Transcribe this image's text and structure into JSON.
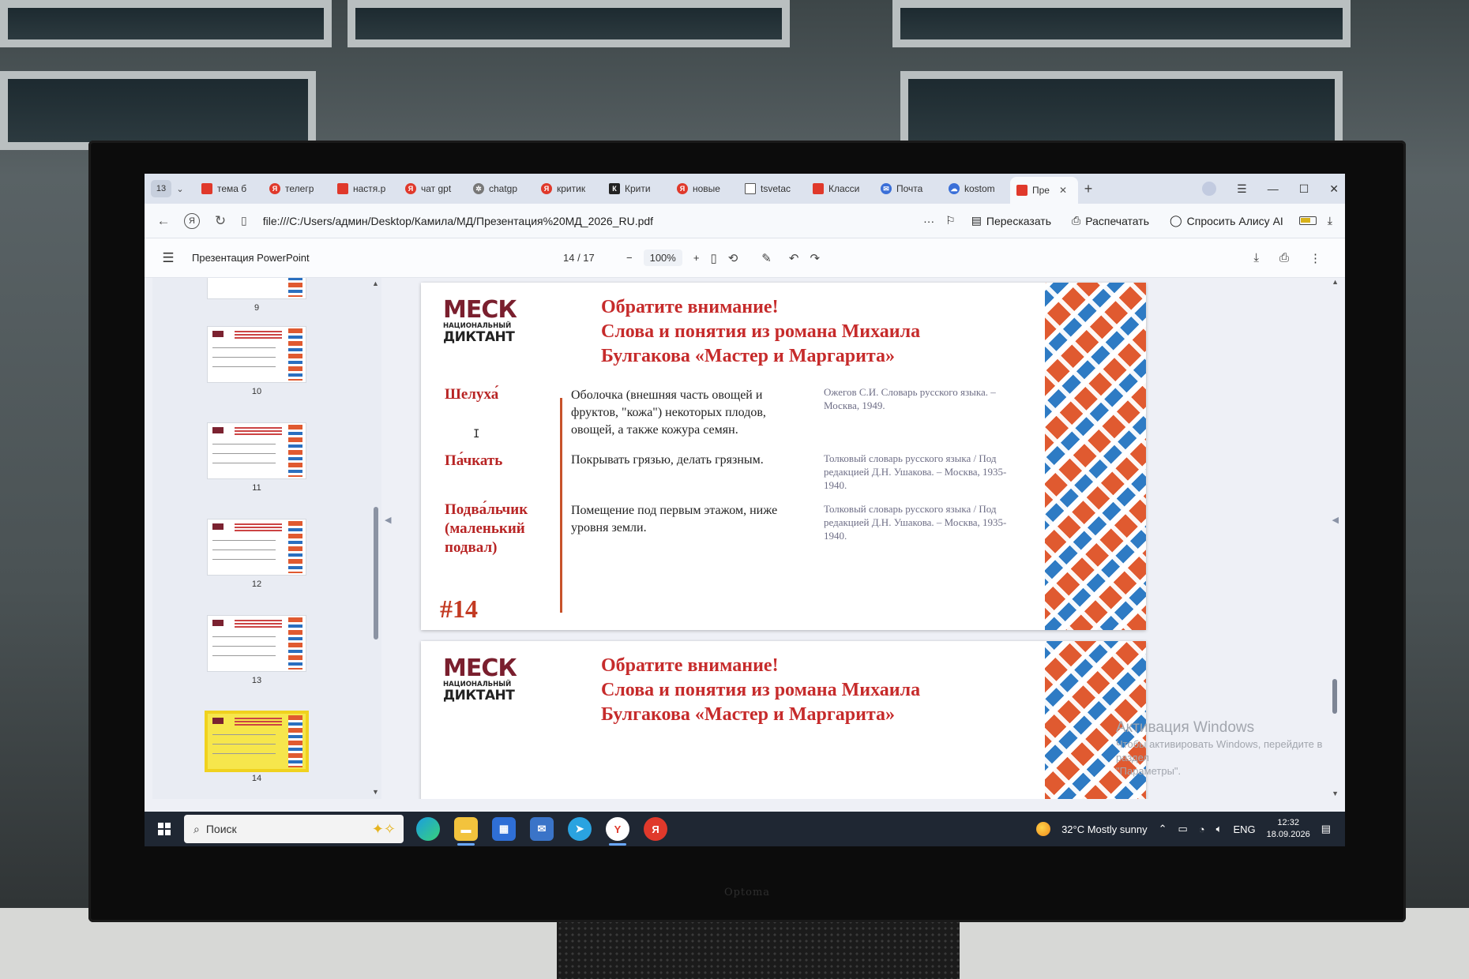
{
  "tabs": {
    "count": "13",
    "items": [
      {
        "label": "тема б",
        "favicon": "pdf-icon",
        "active": false
      },
      {
        "label": "телегр",
        "favicon": "yandex-icon",
        "active": false
      },
      {
        "label": "настя.р",
        "favicon": "pdf-icon",
        "active": false
      },
      {
        "label": "чат gpt",
        "favicon": "yandex-icon",
        "active": false
      },
      {
        "label": "chatgp",
        "favicon": "openai-icon",
        "active": false
      },
      {
        "label": "критик",
        "favicon": "yandex-icon",
        "active": false
      },
      {
        "label": "Крити",
        "favicon": "kp-icon",
        "active": false
      },
      {
        "label": "новые",
        "favicon": "yandex-icon",
        "active": false
      },
      {
        "label": "tsvetac",
        "favicon": "book-icon",
        "active": false
      },
      {
        "label": "Класси",
        "favicon": "pdf-icon",
        "active": false
      },
      {
        "label": "Почта",
        "favicon": "mail-icon",
        "active": false
      },
      {
        "label": "kostom",
        "favicon": "cloud-icon",
        "active": false
      },
      {
        "label": "Пре",
        "favicon": "pdf-icon",
        "active": true
      }
    ]
  },
  "address_bar": {
    "url": "file:///C:/Users/админ/Desktop/Камила/МД/Презентация%20МД_2026_RU.pdf",
    "more": "···",
    "retell_label": "Пересказать",
    "print_label": "Распечатать",
    "ask_alice_label": "Спросить Алису AI"
  },
  "pdf_toolbar": {
    "title": "Презентация PowerPoint",
    "page_indicator": "14 / 17",
    "zoom": "100%"
  },
  "thumbnails": {
    "items": [
      {
        "num": "9",
        "selected": false
      },
      {
        "num": "10",
        "selected": false
      },
      {
        "num": "11",
        "selected": false
      },
      {
        "num": "12",
        "selected": false
      },
      {
        "num": "13",
        "selected": false
      },
      {
        "num": "14",
        "selected": true
      }
    ]
  },
  "slide14": {
    "logo": {
      "mesk": "МЕСК",
      "sub": "НАЦИОНАЛЬНЫЙ",
      "big": "ДИКТАНТ"
    },
    "heading_line1": "Обратите внимание!",
    "heading_line2": "Слова и понятия из романа Михаила",
    "heading_line3": "Булгакова «Мастер и Маргарита»",
    "rows": [
      {
        "term": "Шелуха́",
        "definition": "Оболочка (внешняя часть овощей и фруктов, \"кожа\") некоторых плодов, овощей, а также кожура семян.",
        "source": "Ожегов С.И. Словарь русского языка. – Москва, 1949."
      },
      {
        "term": "Па́чкать",
        "definition": "Покрывать грязью, делать грязным.",
        "source": "Толковый словарь русского языка / Под редакцией Д.Н. Ушакова. – Москва,  1935-1940."
      },
      {
        "term": "Подва́льчик (маленький подвал)",
        "definition": "Помещение под первым этажом, ниже уровня земли.",
        "source": "Толковый словарь русского языка / Под редакцией Д.Н. Ушакова. – Москва,  1935-1940."
      }
    ],
    "slide_number": "#14"
  },
  "slide15": {
    "heading_line1": "Обратите внимание!",
    "heading_line2": "Слова и понятия из романа Михаила",
    "heading_line3": "Булгакова «Мастер и Маргарита»"
  },
  "watermark": {
    "title": "Активация Windows",
    "line1": "Чтобы активировать Windows, перейдите в раздел",
    "line2": "\"Параметры\"."
  },
  "taskbar": {
    "search_label": "Поиск",
    "weather": "32°C  Mostly sunny",
    "lang": "ENG",
    "time": "12:32",
    "date": "18.09.2026"
  },
  "colors": {
    "accent_red": "#c62b2b",
    "pattern_orange": "#e05a30",
    "pattern_blue": "#2e7bc4",
    "taskbar": "#1f2733"
  }
}
